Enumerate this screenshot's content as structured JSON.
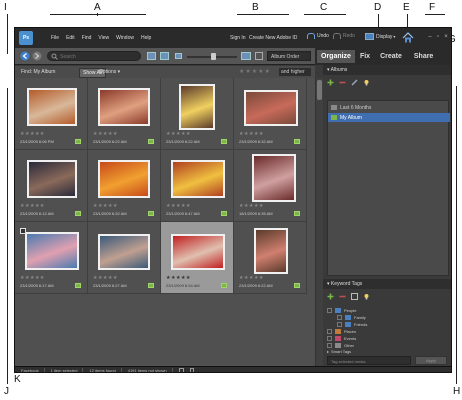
{
  "callouts": [
    "A",
    "B",
    "C",
    "D",
    "E",
    "F",
    "G",
    "H",
    "I",
    "J",
    "K"
  ],
  "menu": {
    "logo": "Ps",
    "items": [
      "File",
      "Edit",
      "Find",
      "View",
      "Window",
      "Help"
    ],
    "sign_in": "Sign In",
    "create_id": "Create New Adobe ID",
    "undo": "Undo",
    "redo": "Redo",
    "display": "Display",
    "window_controls": [
      "–",
      "▫",
      "×"
    ]
  },
  "toolbar": {
    "search_placeholder": "Search",
    "sort": "Album Order"
  },
  "filter": {
    "find_label": "Find: My Album",
    "show_all": "Show All",
    "options": "Options ▾",
    "stars": "★★★★★",
    "rating": "and higher"
  },
  "modes": [
    "Organize",
    "Fix",
    "Create",
    "Share"
  ],
  "albums": {
    "header": "Albums",
    "items": [
      {
        "label": "Last 6 Months",
        "selected": false
      },
      {
        "label": "My Album",
        "selected": true
      }
    ]
  },
  "keyword_tags": {
    "header": "Keyword Tags",
    "items": [
      "People",
      "Family",
      "Friends",
      "Places",
      "Events",
      "Other",
      "Smart Tags"
    ],
    "input_placeholder": "Tag selected media",
    "apply": "Apply"
  },
  "photos": [
    {
      "stars": "★★★★★",
      "date": "23/1/2009 6:06 PM",
      "colors": [
        "#b45b2a",
        "#d8b89a"
      ]
    },
    {
      "stars": "★★★★★",
      "date": "23/1/2009 6:22 AM",
      "colors": [
        "#8a3a2a",
        "#e0a080"
      ]
    },
    {
      "stars": "★★★★★",
      "date": "23/1/2009 6:22 AM",
      "colors": [
        "#5a3a2a",
        "#f0d060"
      ]
    },
    {
      "stars": "★★★★★",
      "date": "23/1/2009 6:32 AM",
      "colors": [
        "#7a4a3a",
        "#c86a5a"
      ]
    },
    {
      "stars": "★★★★★",
      "date": "23/1/2009 6:12 AM",
      "colors": [
        "#2a2a3a",
        "#8a6a5a"
      ]
    },
    {
      "stars": "★★★★★",
      "date": "23/1/2009 6:32 AM",
      "colors": [
        "#c84a1a",
        "#f0a030"
      ]
    },
    {
      "stars": "★★★★★",
      "date": "23/1/2009 6:47 AM",
      "colors": [
        "#b04020",
        "#f0c040"
      ]
    },
    {
      "stars": "★★★★★",
      "date": "18/1/2009 6:35 AM",
      "colors": [
        "#6a2a2a",
        "#d0a0a0"
      ]
    },
    {
      "stars": "★★★★★",
      "date": "23/1/2009 6:17 AM",
      "colors": [
        "#4a7ab0",
        "#e0a0b0"
      ]
    },
    {
      "stars": "★★★★★",
      "date": "23/1/2009 6:27 AM",
      "colors": [
        "#3a5a7a",
        "#c0a090"
      ]
    },
    {
      "stars": "★★★★★",
      "date": "23/1/2009 6:34 AM",
      "colors": [
        "#c02020",
        "#e0c0b0"
      ]
    },
    {
      "stars": "★★★★★",
      "date": "23/1/2009 6:22 AM",
      "colors": [
        "#5a3a2a",
        "#d08070"
      ]
    }
  ],
  "status": {
    "facebook": "Facebook",
    "selected": "1 item selected",
    "found": "12 items found",
    "not_shown": "4191 items not shown"
  }
}
